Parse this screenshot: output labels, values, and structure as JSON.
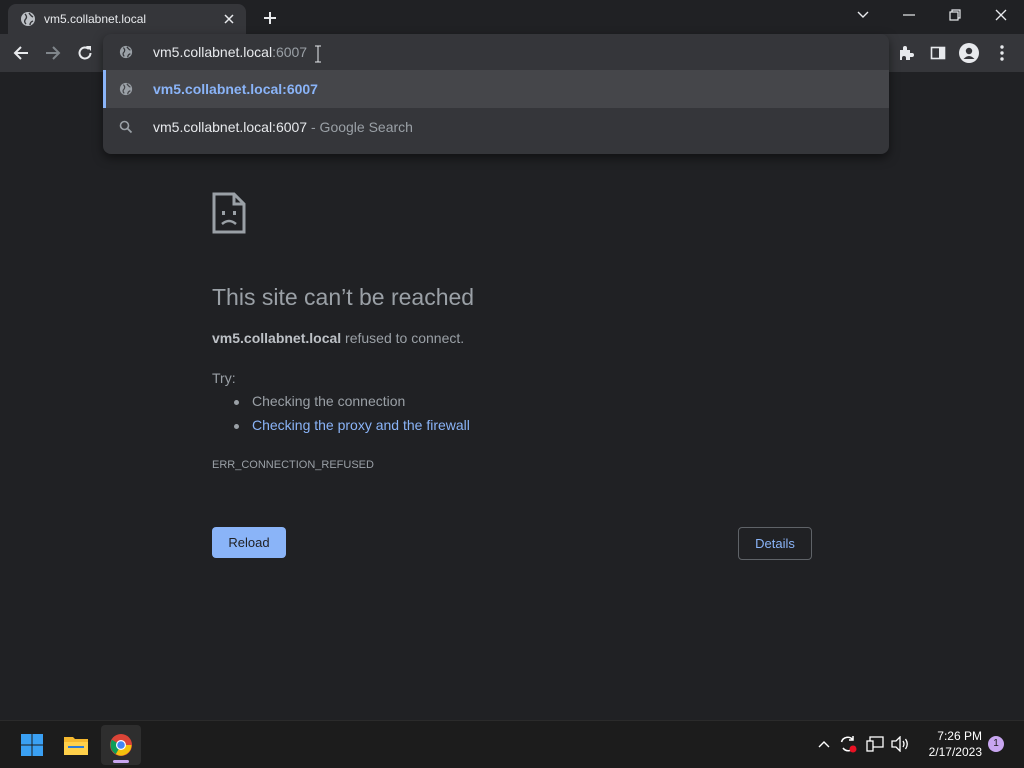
{
  "tab": {
    "title": "vm5.collabnet.local"
  },
  "omnibox": {
    "input_typed": "vm5.collabnet.local",
    "input_suffix": ":6007",
    "suggestions": [
      {
        "text": "vm5.collabnet.local:6007",
        "sub": "",
        "icon": "globe-icon"
      },
      {
        "text": "vm5.collabnet.local:6007",
        "sub": " - Google Search",
        "icon": "search-icon"
      }
    ]
  },
  "error": {
    "title": "This site can’t be reached",
    "host": "vm5.collabnet.local",
    "message": " refused to connect.",
    "try_label": "Try:",
    "suggestions": [
      "Checking the connection",
      "Checking the proxy and the firewall"
    ],
    "code": "ERR_CONNECTION_REFUSED",
    "reload_label": "Reload",
    "details_label": "Details"
  },
  "taskbar": {
    "time": "7:26 PM",
    "date": "2/17/2023",
    "notification_count": "1"
  },
  "colors": {
    "accent": "#8ab4f8",
    "background": "#202124",
    "toolbar": "#35363a"
  }
}
